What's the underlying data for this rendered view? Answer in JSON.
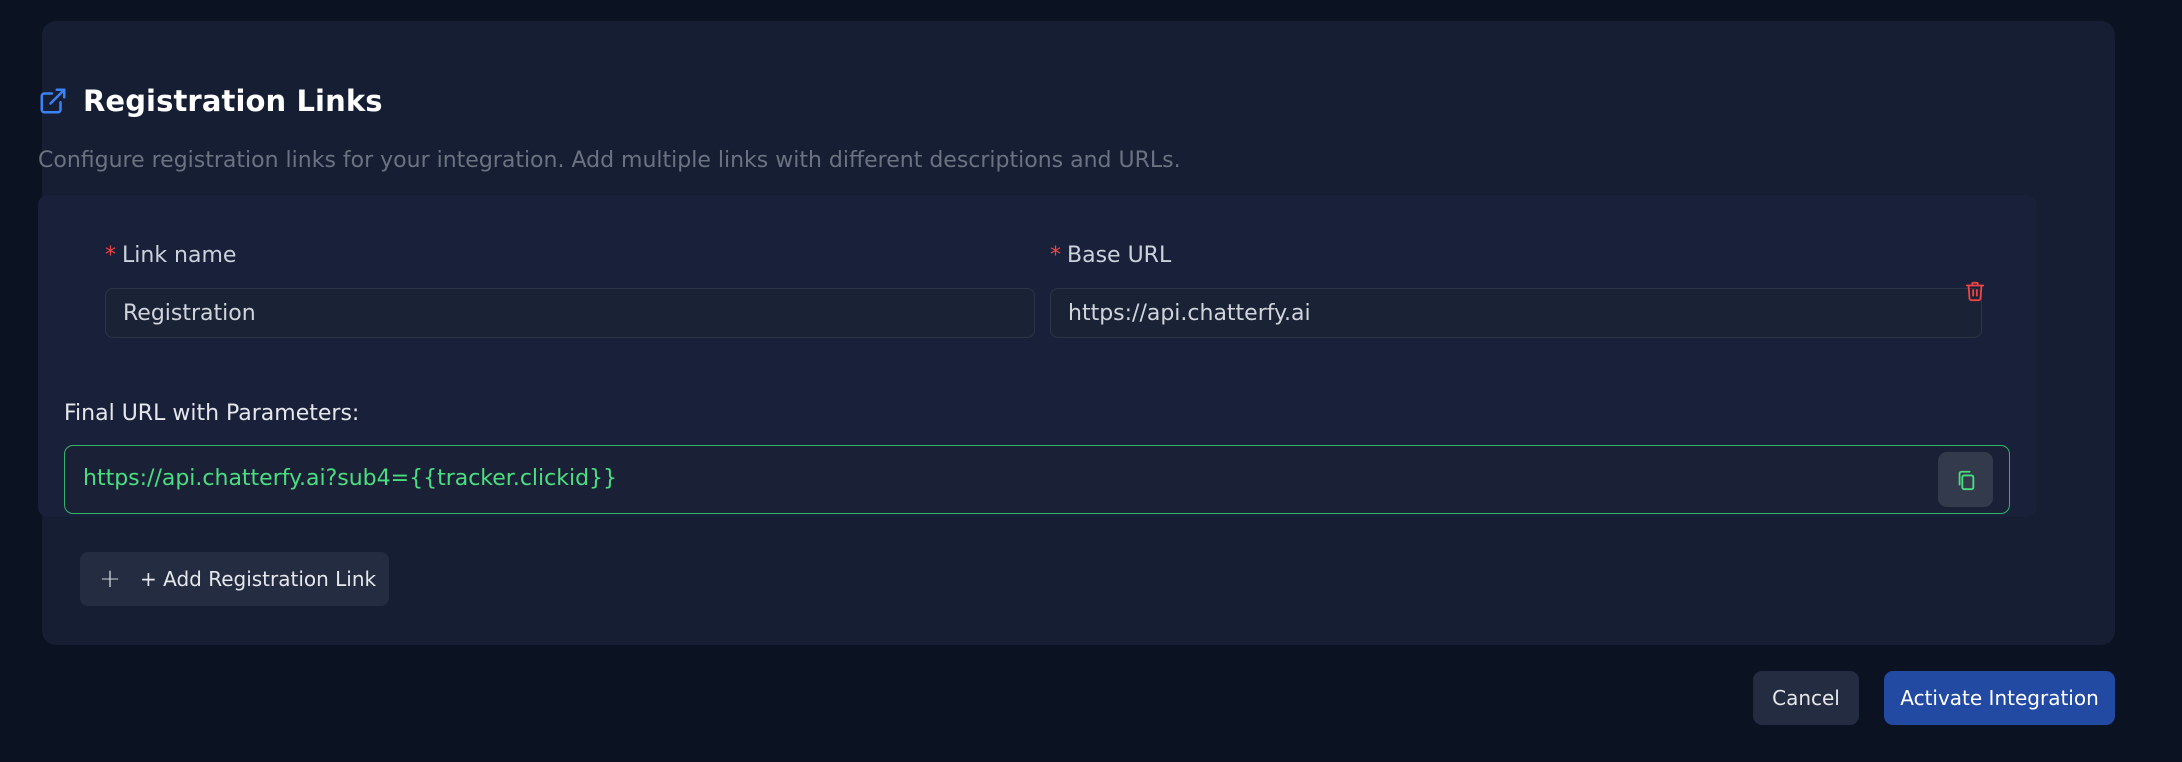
{
  "card": {
    "title": "Registration Links",
    "description": "Configure registration links for your integration. Add multiple links with different descriptions and URLs.",
    "header_icon": "external-link-icon"
  },
  "link": {
    "name_label": "Link name",
    "name_value": "Registration",
    "base_url_label": "Base URL",
    "base_url_value": "https://api.chatterfy.ai",
    "required_marker": "*",
    "delete_icon": "trash-icon",
    "final_url_label": "Final URL with Parameters:",
    "final_url_value": "https://api.chatterfy.ai?sub4={{tracker.clickid}}",
    "copy_icon": "copy-icon"
  },
  "actions": {
    "add_link_icon": "plus-icon",
    "add_link_label": "+ Add Registration Link",
    "cancel_label": "Cancel",
    "activate_label": "Activate Integration"
  },
  "colors": {
    "background": "#0b1221",
    "card": "#151e33",
    "accent": "#3b82f6",
    "success": "#4ade80",
    "danger": "#ef4444",
    "primary_button": "#234aa3"
  }
}
